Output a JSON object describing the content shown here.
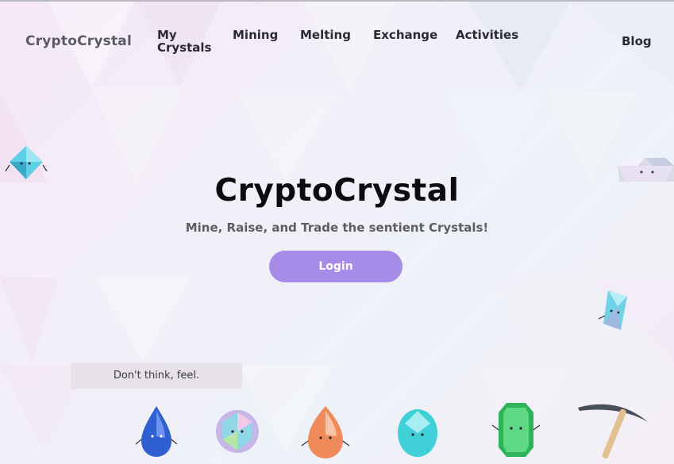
{
  "header": {
    "brand": "CryptoCrystal",
    "nav": {
      "my_crystals_line1": "My",
      "my_crystals_line2": "Crystals",
      "mining": "Mining",
      "melting": "Melting",
      "exchange": "Exchange",
      "activities": "Activities",
      "blog": "Blog"
    }
  },
  "hero": {
    "title": "CryptoCrystal",
    "subtitle": "Mine, Raise, and Trade the sentient Crystals!",
    "login_label": "Login"
  },
  "speech_bubble": "Don't think, feel.",
  "colors": {
    "accent": "#a78be8",
    "background_pink": "#f6e8f7",
    "background_blue": "#eef2f8"
  },
  "decorations": [
    "cyan-octahedron-crystal-icon",
    "diamond-crystal-icon",
    "cyan-shard-crystal-icon",
    "blue-drop-crystal-icon",
    "rainbow-round-crystal-icon",
    "orange-drop-crystal-icon",
    "aqua-oval-crystal-icon",
    "green-emerald-crystal-icon",
    "pickaxe-icon"
  ]
}
